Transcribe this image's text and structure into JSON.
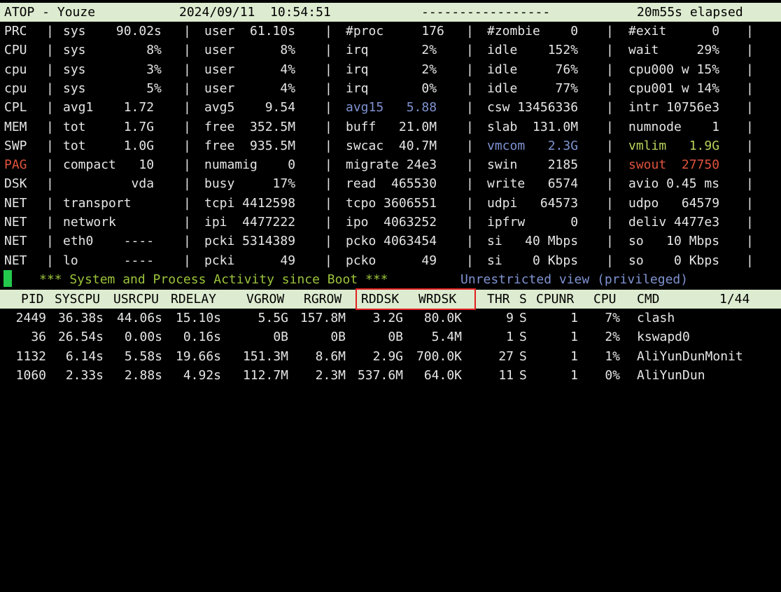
{
  "header": {
    "title": "ATOP - Youze",
    "datetime": "2024/09/11  10:54:51",
    "dashes": "-----------------",
    "elapsed": "20m55s elapsed"
  },
  "rows": [
    {
      "label": "PRC",
      "c1": "sys    90.02s",
      "c2": "user  61.10s",
      "c3": "#proc     176",
      "c4": "#zombie    0",
      "c5": "#exit      0"
    },
    {
      "label": "CPU",
      "c1": "sys        8%",
      "c2": "user      8%",
      "c3": "irq       2%",
      "c4": "idle    152%",
      "c5": "wait     29%"
    },
    {
      "label": "cpu",
      "c1": "sys        3%",
      "c2": "user      4%",
      "c3": "irq       2%",
      "c4": "idle     76%",
      "c5": "cpu000 w 15%"
    },
    {
      "label": "cpu",
      "c1": "sys        5%",
      "c2": "user      4%",
      "c3": "irq       0%",
      "c4": "idle     77%",
      "c5": "cpu001 w 14%"
    },
    {
      "label": "CPL",
      "c1": "avg1    1.72",
      "c2": "avg5    9.54",
      "c3": "avg15   5.88",
      "c4": "csw 13456336",
      "c5": "intr 10756e3"
    },
    {
      "label": "MEM",
      "c1": "tot     1.7G",
      "c2": "free  352.5M",
      "c3": "buff   21.0M",
      "c4": "slab  131.0M",
      "c5": "numnode    1"
    },
    {
      "label": "SWP",
      "c1": "tot     1.0G",
      "c2": "free  935.5M",
      "c3": "swcac  40.7M",
      "c4": "vmcom   2.3G",
      "c5": "vmlim   1.9G"
    },
    {
      "label": "PAG",
      "c1": "compact   10",
      "c2": "numamig    0",
      "c3": "migrate 24e3",
      "c4": "swin    2185",
      "c5": "swout  27750"
    },
    {
      "label": "DSK",
      "c1": "         vda",
      "c2": "busy     17%",
      "c3": "read  465530",
      "c4": "write   6574",
      "c5": "avio 0.45 ms"
    },
    {
      "label": "NET",
      "c1": "transport",
      "c2": "tcpi 4412598",
      "c3": "tcpo 3606551",
      "c4": "udpi   64573",
      "c5": "udpo   64579"
    },
    {
      "label": "NET",
      "c1": "network",
      "c2": "ipi  4477222",
      "c3": "ipo  4063252",
      "c4": "ipfrw      0",
      "c5": "deliv 4477e3"
    },
    {
      "label": "NET",
      "c1": "eth0    ----",
      "c2": "pcki 5314389",
      "c3": "pcko 4063454",
      "c4": "si   40 Mbps",
      "c5": "so   10 Mbps"
    },
    {
      "label": "NET",
      "c1": "lo      ----",
      "c2": "pcki      49",
      "c3": "pcko      49",
      "c4": "si    0 Kbps",
      "c5": "so    0 Kbps"
    }
  ],
  "banner": {
    "activity": "*** System and Process Activity since Boot ***",
    "view": "Unrestricted view (privileged)"
  },
  "proc_header": {
    "cols": [
      "PID",
      "SYSCPU",
      "USRCPU",
      "RDELAY",
      "VGROW",
      "RGROW",
      "RDDSK",
      "WRDSK",
      "THR",
      "S",
      "CPUNR",
      "CPU",
      "CMD"
    ],
    "page": "1/44"
  },
  "processes": [
    {
      "pid": "2449",
      "syscpu": "36.38s",
      "usrcpu": "44.06s",
      "rdelay": "15.10s",
      "vgrow": "5.5G",
      "rgrow": "157.8M",
      "rddsk": "3.2G",
      "wrdsk": "80.0K",
      "thr": "9",
      "s": "S",
      "cpunr": "1",
      "cpu": "7%",
      "cmd": "clash"
    },
    {
      "pid": "36",
      "syscpu": "26.54s",
      "usrcpu": "0.00s",
      "rdelay": "0.16s",
      "vgrow": "0B",
      "rgrow": "0B",
      "rddsk": "0B",
      "wrdsk": "5.4M",
      "thr": "1",
      "s": "S",
      "cpunr": "1",
      "cpu": "2%",
      "cmd": "kswapd0"
    },
    {
      "pid": "1132",
      "syscpu": "6.14s",
      "usrcpu": "5.58s",
      "rdelay": "19.66s",
      "vgrow": "151.3M",
      "rgrow": "8.6M",
      "rddsk": "2.9G",
      "wrdsk": "700.0K",
      "thr": "27",
      "s": "S",
      "cpunr": "1",
      "cpu": "1%",
      "cmd": "AliYunDunMonit"
    },
    {
      "pid": "1060",
      "syscpu": "2.33s",
      "usrcpu": "2.88s",
      "rdelay": "4.92s",
      "vgrow": "112.7M",
      "rgrow": "2.3M",
      "rddsk": "537.6M",
      "wrdsk": "64.0K",
      "thr": "11",
      "s": "S",
      "cpunr": "1",
      "cpu": "0%",
      "cmd": "AliYunDun"
    }
  ],
  "colors": {
    "header_bg": "#ddebd0",
    "blue": "#7f93d2",
    "green": "#b8d35c",
    "red": "#e0533d",
    "cursor": "#23c94d",
    "highlight_box": "#e0201f"
  }
}
